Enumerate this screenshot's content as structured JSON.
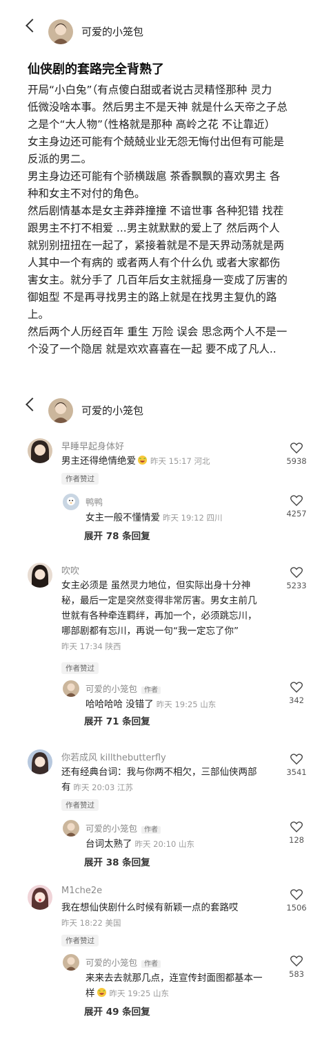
{
  "post_header": {
    "username": "可爱的小笼包"
  },
  "post": {
    "title": "仙侠剧的套路完全背熟了",
    "lines": [
      "开局“小白兔”（有点傻白甜或者说古灵精怪那种 灵力",
      "低微没啥本事。然后男主不是天神 就是什么天帝之子总",
      "之是个“大人物”（性格就是那种 高岭之花 不让靠近）",
      "女主身边还可能有个兢兢业业无怨无悔付出但有可能是",
      "反派的男二。",
      "男主身边还可能有个骄横跋扈 茶香飘飘的喜欢男主 各",
      "种和女主不对付的角色。",
      "然后剧情基本是女主莽莽撞撞 不谙世事 各种犯错 找茬",
      "跟男主不打不相爱 ...男主就默默的爱上了 然后两个人",
      "就别别扭扭在一起了，紧接着就是不是天界动荡就是两",
      "人其中一个有病的 或者两人有个什么仇 或者大家都伤",
      "害女主。就分手了 几百年后女主就摇身一变成了厉害的",
      "御姐型 不是再寻找男主的路上就是在找男主复仇的路",
      "上。",
      "然后两个人历经百年 重生 万险 误会 思念两个人不是一",
      "个没了一个隐居 就是欢欢喜喜在一起 要不成了凡人.."
    ]
  },
  "comments_header": {
    "username": "可爱的小笼包"
  },
  "author_liked_label": "作者赞过",
  "author_tag": "作者",
  "comments": [
    {
      "user": "早睡早起身体好",
      "lines": [
        "男主还得绝情绝爱"
      ],
      "meta": "昨天 15:17 河北",
      "likes": "5938",
      "reply": {
        "user": "鸭鸭",
        "text": "女主一般不懂情爱",
        "meta": "昨天 19:12 四川",
        "likes": "4257"
      },
      "expand": "展开 78 条回复"
    },
    {
      "user": "吹吹",
      "lines": [
        "女主必须是 虽然灵力地位，但实际出身十分神",
        "秘，最后一定是突然变得非常厉害。男女主前几",
        "世就有各种牵连羁绊，再加一个，必须跳忘川，",
        "哪部剧都有忘川，再说一句“我一定忘了你”"
      ],
      "meta": "昨天 17:34 陕西",
      "likes": "5233",
      "reply": {
        "user": "可爱的小笼包",
        "text": "哈哈哈哈 没错了",
        "meta": "昨天 19:25 山东",
        "likes": "342"
      },
      "expand": "展开 71 条回复"
    },
    {
      "user": "你若成风 killthebutterfly",
      "lines": [
        "还有经典台词：我与你两不相欠，三部仙侠两部",
        "有"
      ],
      "meta": "昨天 20:03 江苏",
      "likes": "3541",
      "reply": {
        "user": "可爱的小笼包",
        "text": "台词太熟了",
        "meta": "昨天 20:10 山东",
        "likes": "128"
      },
      "expand": "展开 38 条回复"
    },
    {
      "user": "M1che2e",
      "lines": [
        "我在想仙侠剧什么时候有新颖一点的套路哎"
      ],
      "meta": "昨天 18:22 美国",
      "likes": "1506",
      "reply": {
        "user": "可爱的小笼包",
        "lines": [
          "来来去去就那几点，连宣传封面图都基本一",
          "样"
        ],
        "meta": "昨天 19:25 山东",
        "likes": "583"
      },
      "expand": "展开 49 条回复"
    }
  ],
  "colors": {
    "text": "#222222",
    "meta": "#9a9a9a",
    "username": "#8a8a8a",
    "background": "#ffffff"
  },
  "icons": [
    "back-arrow-icon",
    "heart-icon",
    "laugh-cry-emoji-icon"
  ]
}
